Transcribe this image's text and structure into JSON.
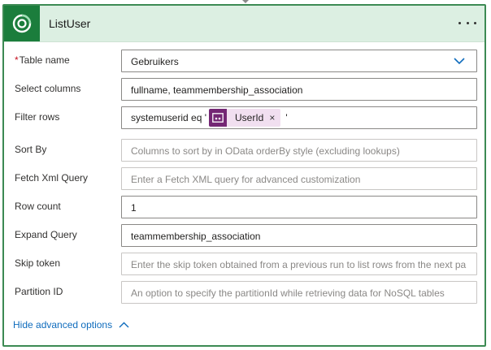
{
  "card": {
    "title": "ListUser",
    "colors": {
      "border": "#3c8a53",
      "header_bg": "#dcefe2",
      "tile": "#1b7d3c",
      "link": "#0f6cbd",
      "token": "#742774"
    }
  },
  "fields": {
    "table_name": {
      "label": "Table name",
      "required_mark": "*",
      "value": "Gebruikers"
    },
    "select_columns": {
      "label": "Select columns",
      "value": "fullname, teammembership_association"
    },
    "filter_rows": {
      "label": "Filter rows",
      "prefix": "systemuserid eq '",
      "token": "UserId",
      "token_close": "×",
      "suffix": "'"
    },
    "sort_by": {
      "label": "Sort By",
      "placeholder": "Columns to sort by in OData orderBy style (excluding lookups)"
    },
    "fetch_xml": {
      "label": "Fetch Xml Query",
      "placeholder": "Enter a Fetch XML query for advanced customization"
    },
    "row_count": {
      "label": "Row count",
      "value": "1"
    },
    "expand_query": {
      "label": "Expand Query",
      "value": "teammembership_association"
    },
    "skip_token": {
      "label": "Skip token",
      "placeholder": "Enter the skip token obtained from a previous run to list rows from the next pa"
    },
    "partition_id": {
      "label": "Partition ID",
      "placeholder": "An option to specify the partitionId while retrieving data for NoSQL tables"
    }
  },
  "footer": {
    "advanced_toggle": "Hide advanced options"
  },
  "icons": {
    "app": "dataverse-icon",
    "more": "more-icon",
    "dropdown": "chevron-down-icon",
    "token_app": "power-apps-icon",
    "collapse": "chevron-up-icon"
  }
}
